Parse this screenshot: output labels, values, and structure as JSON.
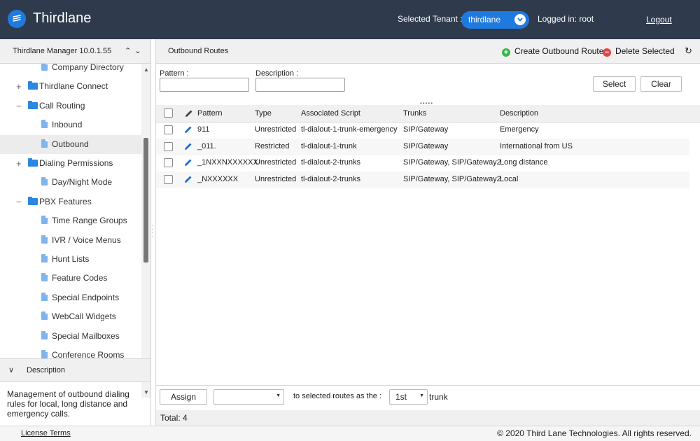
{
  "header": {
    "app_title": "Thirdlane",
    "tenant_label": "Selected Tenant :",
    "tenant_value": "thirdlane",
    "logged_in": "Logged in: root",
    "logout": "Logout"
  },
  "sidebar": {
    "title": "Thirdlane Manager 10.0.1.55",
    "tree": [
      {
        "label": "Company Directory",
        "kind": "file",
        "toggle": ""
      },
      {
        "label": "Thirdlane Connect",
        "kind": "folder",
        "toggle": "+"
      },
      {
        "label": "Call Routing",
        "kind": "folder",
        "toggle": "−"
      },
      {
        "label": "Inbound",
        "kind": "file",
        "toggle": ""
      },
      {
        "label": "Outbound",
        "kind": "file",
        "toggle": "",
        "selected": true
      },
      {
        "label": "Dialing Permissions",
        "kind": "folder",
        "toggle": "+"
      },
      {
        "label": "Day/Night Mode",
        "kind": "file",
        "toggle": ""
      },
      {
        "label": "PBX Features",
        "kind": "folder",
        "toggle": "−"
      },
      {
        "label": "Time Range Groups",
        "kind": "file",
        "toggle": ""
      },
      {
        "label": "IVR / Voice Menus",
        "kind": "file",
        "toggle": ""
      },
      {
        "label": "Hunt Lists",
        "kind": "file",
        "toggle": ""
      },
      {
        "label": "Feature Codes",
        "kind": "file",
        "toggle": ""
      },
      {
        "label": "Special Endpoints",
        "kind": "file",
        "toggle": ""
      },
      {
        "label": "WebCall Widgets",
        "kind": "file",
        "toggle": ""
      },
      {
        "label": "Special Mailboxes",
        "kind": "file",
        "toggle": ""
      },
      {
        "label": "Conference Rooms",
        "kind": "file",
        "toggle": ""
      }
    ],
    "description_title": "Description",
    "description_text": "Management of outbound dialing rules for local, long distance and emergency calls."
  },
  "main": {
    "title": "Outbound Routes",
    "create_label": "Create Outbound Route",
    "delete_label": "Delete Selected",
    "filters": {
      "pattern_label": "Pattern :",
      "pattern_value": "",
      "description_label": "Description :",
      "description_value": "",
      "select_label": "Select",
      "clear_label": "Clear"
    },
    "columns": {
      "pattern": "Pattern",
      "type": "Type",
      "script": "Associated Script",
      "trunks": "Trunks",
      "description": "Description"
    },
    "rows": [
      {
        "pattern": "911",
        "type": "Unrestricted",
        "script": "tl-dialout-1-trunk-emergency",
        "trunks": "SIP/Gateway",
        "description": "Emergency"
      },
      {
        "pattern": "_011.",
        "type": "Restricted",
        "script": "tl-dialout-1-trunk",
        "trunks": "SIP/Gateway",
        "description": "International from US"
      },
      {
        "pattern": "_1NXXNXXXXXX",
        "type": "Unrestricted",
        "script": "tl-dialout-2-trunks",
        "trunks": "SIP/Gateway, SIP/Gateway2",
        "description": "Long distance"
      },
      {
        "pattern": "_NXXXXXX",
        "type": "Unrestricted",
        "script": "tl-dialout-2-trunks",
        "trunks": "SIP/Gateway, SIP/Gateway2",
        "description": "Local"
      }
    ],
    "bottom": {
      "assign_label": "Assign",
      "trunk_select_value": "",
      "mid_text": "to selected routes as the  :",
      "position_value": "1st",
      "trunk_text": "trunk",
      "total": "Total: 4"
    }
  },
  "footer": {
    "license": "License Terms",
    "copyright": "© 2020 Third Lane Technologies. All rights reserved."
  },
  "colors": {
    "header_bg": "#2f3b4d",
    "accent": "#1f7ae0",
    "create_icon": "#3cb44b",
    "delete_icon": "#e04848"
  },
  "icons": {
    "logo": "stack-icon",
    "tenant_chevron": "chevron-down-icon",
    "collapse": "double-chevron-up-icon",
    "expand": "double-chevron-down-icon",
    "edit": "pencil-icon",
    "refresh": "refresh-icon"
  }
}
